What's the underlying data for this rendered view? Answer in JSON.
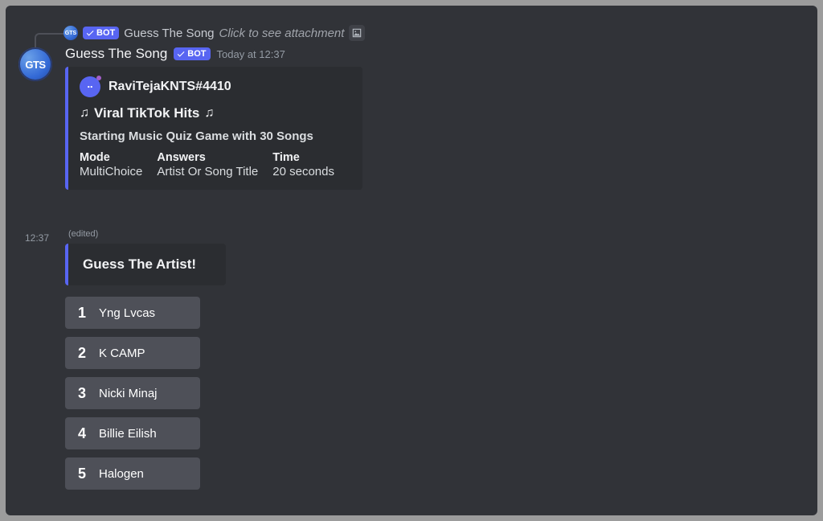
{
  "reply": {
    "avatar_text": "GTS",
    "name": "Guess The Song",
    "attachment_text": "Click to see attachment"
  },
  "bot_tag": "BOT",
  "message": {
    "avatar_text": "GTS",
    "author": "Guess The Song",
    "timestamp": "Today at 12:37"
  },
  "embed1": {
    "author": "RaviTejaKNTS#4410",
    "title": "Viral TikTok Hits",
    "description": "Starting Music Quiz Game with 30 Songs",
    "fields": {
      "mode": {
        "name": "Mode",
        "value": "MultiChoice"
      },
      "answers": {
        "name": "Answers",
        "value": "Artist Or Song Title"
      },
      "time": {
        "name": "Time",
        "value": "20 seconds"
      }
    }
  },
  "message2": {
    "time": "12:37",
    "edited": "(edited)"
  },
  "embed2": {
    "title": "Guess The Artist!"
  },
  "options": [
    {
      "num": "1",
      "label": "Yng Lvcas"
    },
    {
      "num": "2",
      "label": "K CAMP"
    },
    {
      "num": "3",
      "label": "Nicki Minaj"
    },
    {
      "num": "4",
      "label": "Billie Eilish"
    },
    {
      "num": "5",
      "label": "Halogen"
    }
  ]
}
